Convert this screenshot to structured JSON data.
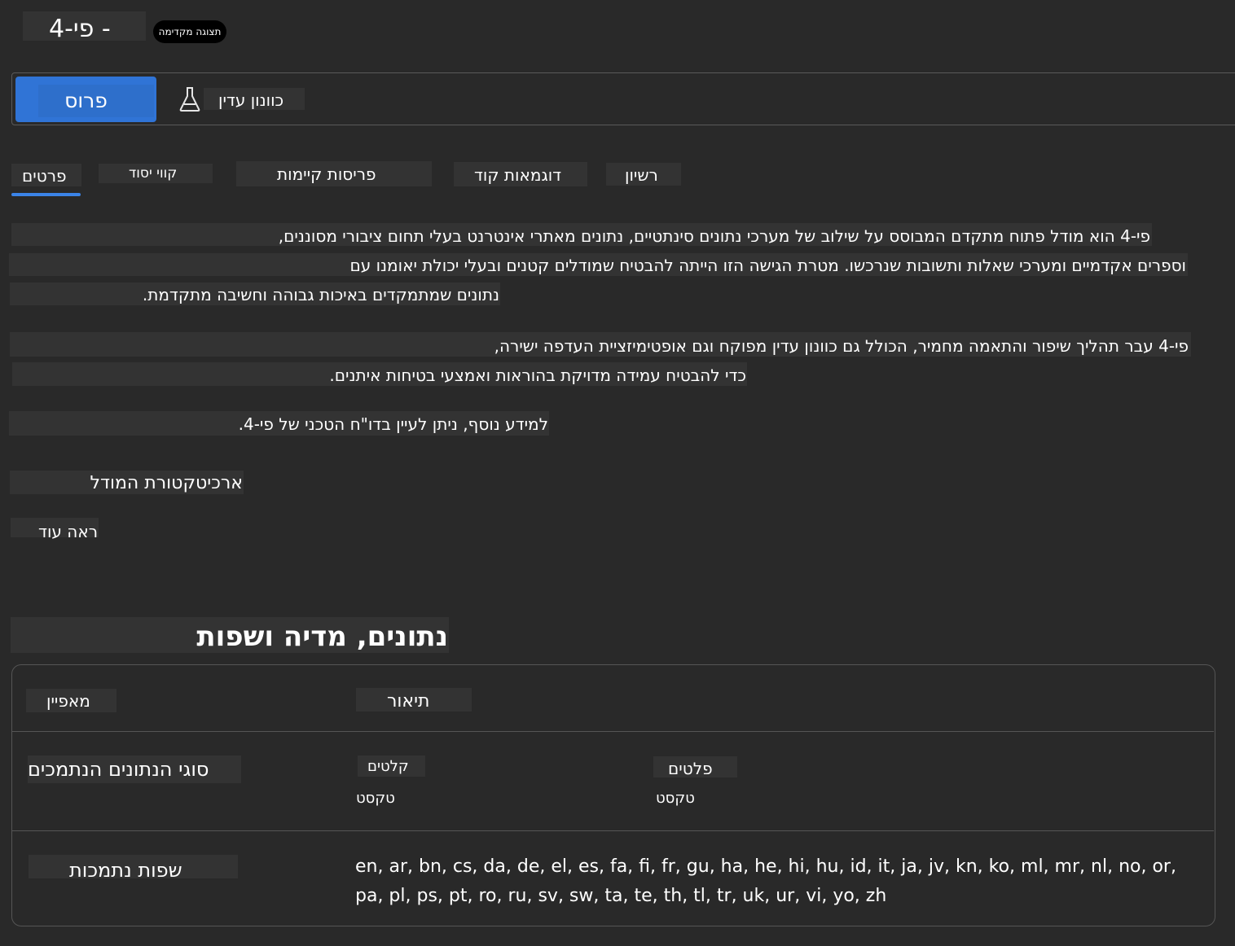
{
  "header": {
    "title": "פי-4 -",
    "preview_badge": "תצוגה מקדימה"
  },
  "toolbar": {
    "deploy_label": "פרוס",
    "playground_label": "כוונון עדין",
    "playground_icon": "flask-icon"
  },
  "tabs": [
    {
      "label": "פרטים",
      "active": true
    },
    {
      "label": "קווי יסוד"
    },
    {
      "label": "פריסות קיימות"
    },
    {
      "label": "דוגמאות קוד"
    },
    {
      "label": "רשיון"
    }
  ],
  "details": {
    "paragraph1": [
      "פי-4 הוא מודל פתוח מתקדם המבוסס על שילוב של מערכי נתונים סינתטיים, נתונים מאתרי אינטרנט בעלי תחום ציבורי מסוננים,",
      "וספרים אקדמיים ומערכי שאלות ותשובות שנרכשו. מטרת הגישה הזו הייתה להבטיח שמודלים קטנים ובעלי יכולת יאומנו עם",
      "נתונים שמתמקדים באיכות גבוהה וחשיבה מתקדמת."
    ],
    "paragraph2": [
      "פי-4 עבר תהליך שיפור והתאמה מחמיר, הכולל גם כוונון עדין מפוקח וגם אופטימיזציית העדפה ישירה,",
      "כדי להבטיח עמידה מדויקת בהוראות ואמצעי בטיחות איתנים."
    ],
    "paragraph3": "למידע נוסף, ניתן לעיין בדו\"ח הטכני של פי-4.",
    "architecture_heading": "ארכיטקטורת המודל",
    "see_more": "ראה עוד"
  },
  "data_section": {
    "heading": "נתונים, מדיה ושפות",
    "table": {
      "col_feature": "מאפיין",
      "col_description": "תיאור",
      "rows": {
        "data_types": {
          "label": "סוגי הנתונים הנתמכים",
          "inputs_label": "קלטים",
          "inputs_value": "טקסט",
          "outputs_label": "פלטים",
          "outputs_value": "טקסט"
        },
        "languages": {
          "label": "שפות נתמכות",
          "value": "en, ar, bn, cs, da, de, el, es, fa, fi, fr, gu, ha, he, hi, hu, id, it, ja, jv, kn, ko, ml, mr, nl, no, or, pa, pl, ps, pt, ro, ru, sv, sw, ta, te, th, tl, tr, uk, ur, vi, yo, zh"
        }
      }
    }
  },
  "colors": {
    "background": "#292929",
    "accent": "#3074d6",
    "text": "#ffffff"
  }
}
